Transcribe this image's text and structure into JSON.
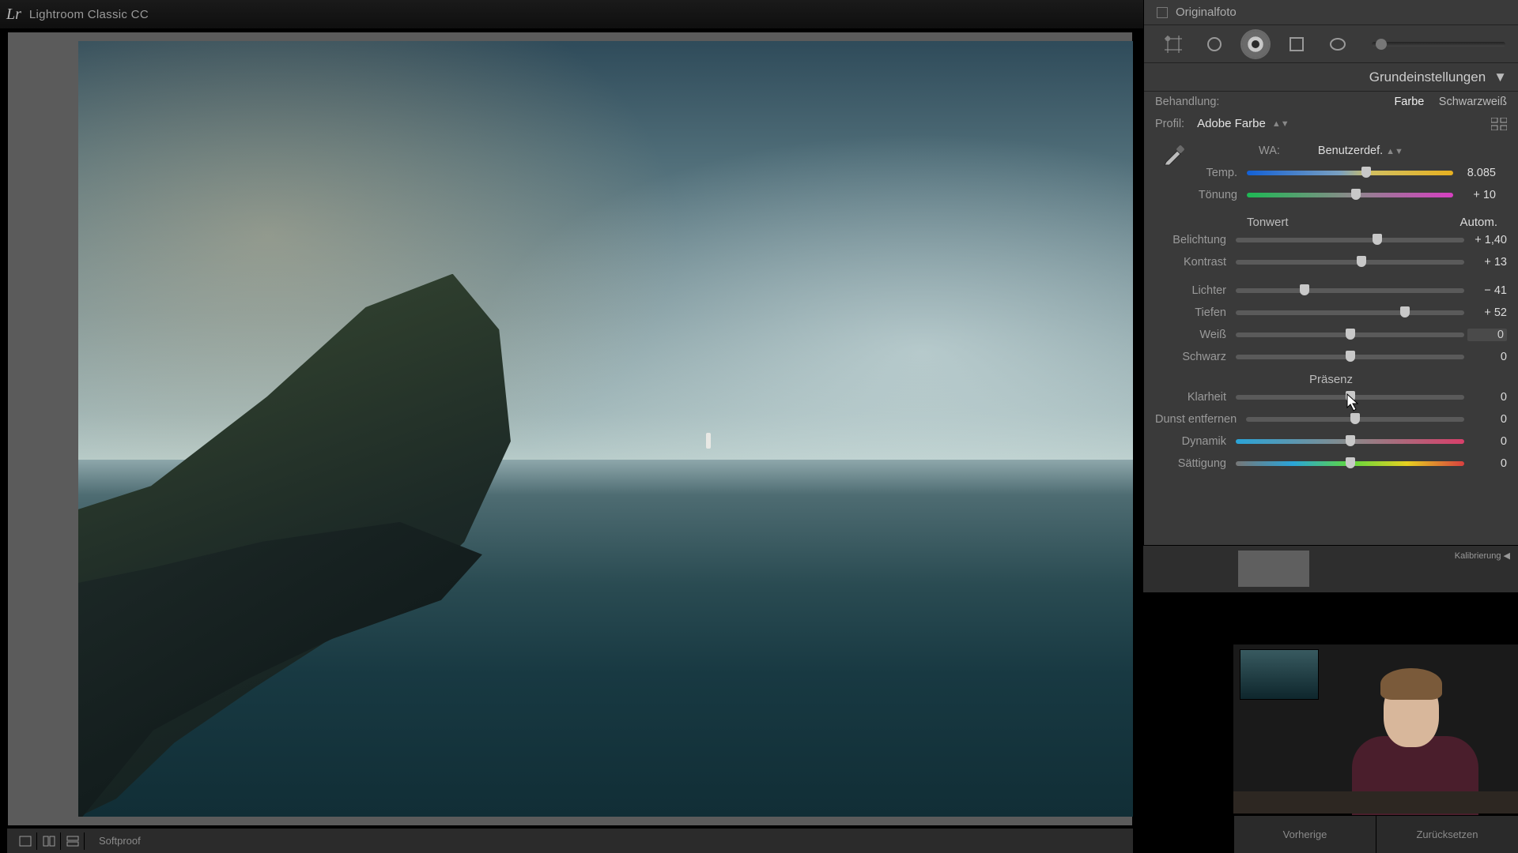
{
  "app": {
    "logo_text": "Lr",
    "name": "Lightroom Classic CC"
  },
  "originalfoto": {
    "label": "Originalfoto",
    "checked": false
  },
  "tools": {
    "crop": "crop-icon",
    "spot": "circle-icon",
    "redeye": "target-icon",
    "gradient": "rect-icon",
    "radial": "ellipse-icon",
    "brush": "brush-slider"
  },
  "basic_panel": {
    "title": "Grundeinstellungen",
    "treatment": {
      "label": "Behandlung:",
      "color": "Farbe",
      "bw": "Schwarzweiß",
      "active": "color"
    },
    "profile": {
      "label": "Profil:",
      "value": "Adobe Farbe"
    },
    "wb": {
      "heading": "WA:",
      "preset": "Benutzerdef.",
      "temp": {
        "label": "Temp.",
        "value": "8.085",
        "pos": 58
      },
      "tint": {
        "label": "Tönung",
        "value": "+ 10",
        "pos": 53
      }
    },
    "tone": {
      "heading": "Tonwert",
      "auto": "Autom.",
      "exposure": {
        "label": "Belichtung",
        "value": "+ 1,40",
        "pos": 62
      },
      "contrast": {
        "label": "Kontrast",
        "value": "+ 13",
        "pos": 55
      },
      "highlights": {
        "label": "Lichter",
        "value": "− 41",
        "pos": 30
      },
      "shadows": {
        "label": "Tiefen",
        "value": "+ 52",
        "pos": 74
      },
      "whites": {
        "label": "Weiß",
        "value": "0",
        "pos": 50
      },
      "blacks": {
        "label": "Schwarz",
        "value": "0",
        "pos": 50
      }
    },
    "presence": {
      "heading": "Präsenz",
      "clarity": {
        "label": "Klarheit",
        "value": "0",
        "pos": 50
      },
      "dehaze": {
        "label": "Dunst entfernen",
        "value": "0",
        "pos": 50
      },
      "vibrance": {
        "label": "Dynamik",
        "value": "0",
        "pos": 50
      },
      "saturation": {
        "label": "Sättigung",
        "value": "0",
        "pos": 50
      }
    }
  },
  "strip": {
    "calibration_label": "Kalibrierung"
  },
  "bottom": {
    "softproof": "Softproof",
    "previous": "Vorherige",
    "reset": "Zurücksetzen"
  }
}
